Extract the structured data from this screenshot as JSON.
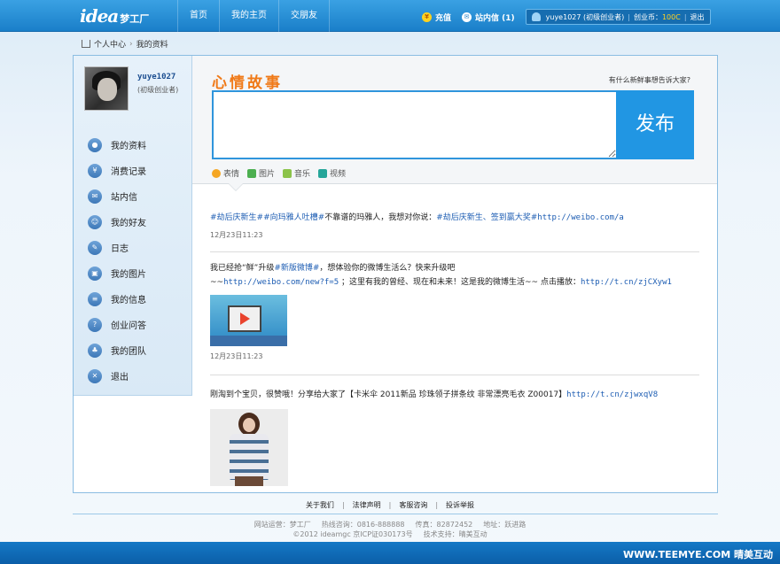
{
  "header": {
    "logo_text": "idea",
    "logo_cn": "梦工厂",
    "nav": [
      "首页",
      "我的主页",
      "交朋友"
    ],
    "recharge": "充值",
    "messages": "站内信 (1)",
    "user": "yuye1027 (初级创业者)",
    "coin_label": "创业币：",
    "coin_value": "100C",
    "logout": "退出"
  },
  "breadcrumb": {
    "home": "个人中心",
    "current": "我的资料"
  },
  "profile": {
    "username": "yuye1027",
    "level": "(初级创业者)"
  },
  "menu": [
    {
      "label": "我的资料",
      "icon": "profile-icon",
      "glyph": "●"
    },
    {
      "label": "消费记录",
      "icon": "yen-icon",
      "glyph": "¥"
    },
    {
      "label": "站内信",
      "icon": "mail-icon",
      "glyph": "✉"
    },
    {
      "label": "我的好友",
      "icon": "friends-icon",
      "glyph": "☺"
    },
    {
      "label": "日志",
      "icon": "journal-icon",
      "glyph": "✎"
    },
    {
      "label": "我的图片",
      "icon": "picture-icon",
      "glyph": "▣"
    },
    {
      "label": "我的信息",
      "icon": "info-icon",
      "glyph": "≡"
    },
    {
      "label": "创业问答",
      "icon": "question-icon",
      "glyph": "?"
    },
    {
      "label": "我的团队",
      "icon": "team-icon",
      "glyph": "♣"
    },
    {
      "label": "退出",
      "icon": "exit-icon",
      "glyph": "✕"
    }
  ],
  "composer": {
    "title": "心情故事",
    "hint": "有什么新鲜事想告诉大家?",
    "placeholder": "",
    "publish": "发布",
    "tools": [
      {
        "label": "表情",
        "icon": "emoji-icon",
        "color": "#f5a623"
      },
      {
        "label": "图片",
        "icon": "image-icon",
        "color": "#4caf50"
      },
      {
        "label": "音乐",
        "icon": "music-icon",
        "color": "#8bc34a"
      },
      {
        "label": "视频",
        "icon": "video-icon",
        "color": "#26a69a"
      }
    ]
  },
  "posts": [
    {
      "tag1": "#劫后庆新生#",
      "tag2": "#向玛雅人吐槽#",
      "text": "不靠谱的玛雅人，我想对你说：",
      "tag3": "#劫后庆新生、签到赢大奖#",
      "link": "http://weibo.com/a",
      "time": "12月23日11:23"
    },
    {
      "text1": "我已经抢“鲜”升级",
      "tag": "#新版微博#",
      "text2": "，想体验你的微博生活么？快来升级吧",
      "text3": "~~",
      "link1": "http://weibo.com/new?f=5",
      "text4": " ；这里有我的曾经、现在和未来！这是我的微博生活~~ 点击播放：",
      "link2": "http://t.cn/zjCXyw1",
      "time": "12月23日11:23"
    },
    {
      "text": "刚淘到个宝贝，很赞哦！分享给大家了【卡米伞 2011新品 珍珠领子拼条纹 非常漂亮毛衣 Z00017】",
      "link": "http://t.cn/zjwxqV8"
    }
  ],
  "footer": {
    "links": [
      "关于我们",
      "法律声明",
      "客服咨询",
      "投诉举报"
    ],
    "line1": [
      "网站运营：梦工厂",
      "热线咨询：0816-888888",
      "传真：82872452",
      "地址：跃进路"
    ],
    "line2": [
      "©2012 ideamgc 京ICP证030173号",
      "技术支持：晴美互动"
    ],
    "brand": "WWW.TEEMYE.COM  晴美互动"
  }
}
